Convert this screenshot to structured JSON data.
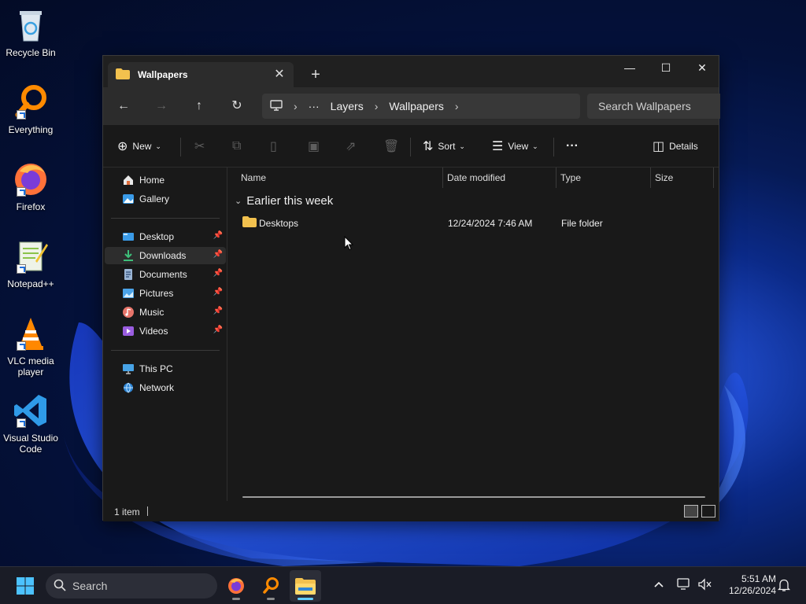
{
  "desktop": {
    "icons": [
      {
        "label": "Recycle Bin",
        "icon": "recycle-bin-icon"
      },
      {
        "label": "Everything",
        "icon": "everything-icon"
      },
      {
        "label": "Firefox",
        "icon": "firefox-icon"
      },
      {
        "label": "Notepad++",
        "icon": "notepad-plus-plus-icon"
      },
      {
        "label": "VLC media player",
        "icon": "vlc-icon"
      },
      {
        "label": "Visual Studio Code",
        "icon": "vscode-icon"
      }
    ]
  },
  "window": {
    "tab_title": "Wallpapers",
    "tab_close": "✕",
    "new_tab": "+",
    "controls": {
      "minimize": "—",
      "maximize": "☐",
      "close": "✕"
    },
    "nav": {
      "back": "←",
      "forward": "→",
      "up": "↑",
      "refresh": "↻"
    },
    "breadcrumb": {
      "more": "···",
      "items": [
        "Layers",
        "Wallpapers"
      ],
      "sep": "›"
    },
    "search_placeholder": "Search Wallpapers",
    "toolbar": {
      "new_label": "New",
      "sort_label": "Sort",
      "view_label": "View",
      "more_label": "···",
      "details_label": "Details"
    },
    "sidebar": {
      "top": [
        {
          "label": "Home",
          "icon": "home-icon"
        },
        {
          "label": "Gallery",
          "icon": "gallery-icon"
        }
      ],
      "pinned": [
        {
          "label": "Desktop",
          "icon": "desktop-folder-icon"
        },
        {
          "label": "Downloads",
          "icon": "downloads-icon"
        },
        {
          "label": "Documents",
          "icon": "documents-icon"
        },
        {
          "label": "Pictures",
          "icon": "pictures-icon"
        },
        {
          "label": "Music",
          "icon": "music-icon"
        },
        {
          "label": "Videos",
          "icon": "videos-icon"
        }
      ],
      "bottom": [
        {
          "label": "This PC",
          "icon": "this-pc-icon"
        },
        {
          "label": "Network",
          "icon": "network-icon"
        }
      ]
    },
    "columns": {
      "name": "Name",
      "date": "Date modified",
      "type": "Type",
      "size": "Size"
    },
    "group_label": "Earlier this week",
    "files": [
      {
        "name": "Desktops",
        "date": "12/24/2024 7:46 AM",
        "type": "File folder",
        "size": ""
      }
    ],
    "status": "1 item"
  },
  "taskbar": {
    "search_label": "Search",
    "time": "5:51 AM",
    "date": "12/26/2024"
  },
  "colors": {
    "accent": "#60cdff",
    "folder": "#f2c14e",
    "window_bg": "#191919"
  }
}
